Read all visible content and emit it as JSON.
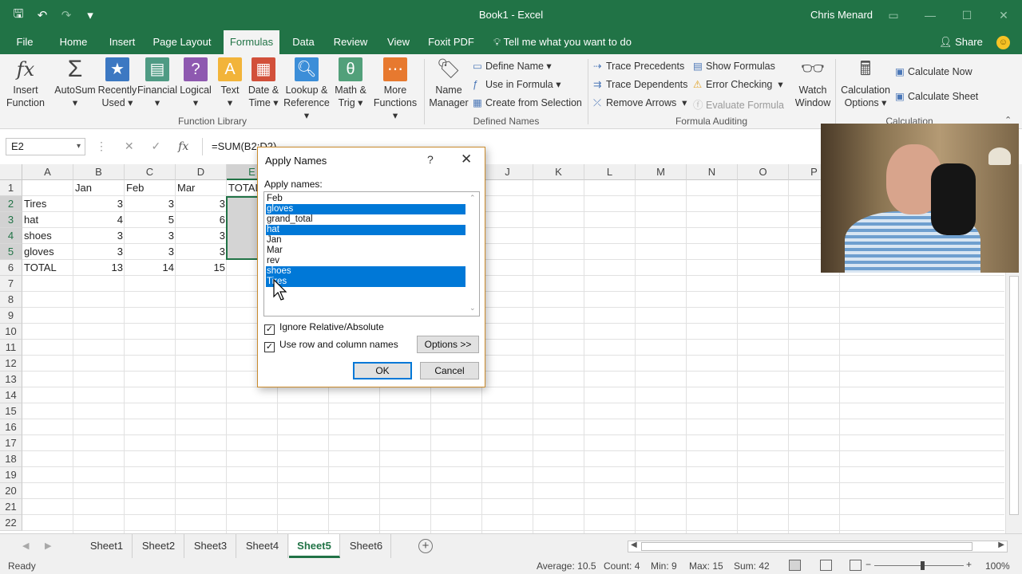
{
  "window": {
    "doc_title": "Book1  -  Excel",
    "user_name": "Chris Menard"
  },
  "tabs": [
    "File",
    "Home",
    "Insert",
    "Page Layout",
    "Formulas",
    "Data",
    "Review",
    "View",
    "Foxit PDF"
  ],
  "active_tab": "Formulas",
  "tell_me": "Tell me what you want to do",
  "share_label": "Share",
  "ribbon": {
    "function_library": {
      "label": "Function Library",
      "buttons": [
        {
          "line1": "Insert",
          "line2": "Function"
        },
        {
          "line1": "AutoSum",
          "line2": "▾"
        },
        {
          "line1": "Recently",
          "line2": "Used ▾"
        },
        {
          "line1": "Financial",
          "line2": "▾"
        },
        {
          "line1": "Logical",
          "line2": "▾"
        },
        {
          "line1": "Text",
          "line2": "▾"
        },
        {
          "line1": "Date &",
          "line2": "Time ▾"
        },
        {
          "line1": "Lookup &",
          "line2": "Reference ▾"
        },
        {
          "line1": "Math &",
          "line2": "Trig ▾"
        },
        {
          "line1": "More",
          "line2": "Functions ▾"
        }
      ]
    },
    "defined_names": {
      "label": "Defined Names",
      "name_manager": {
        "line1": "Name",
        "line2": "Manager"
      },
      "items": [
        "Define Name",
        "Use in Formula",
        "Create from Selection"
      ]
    },
    "formula_auditing": {
      "label": "Formula Auditing",
      "items": [
        "Trace Precedents",
        "Trace Dependents",
        "Remove Arrows",
        "Show Formulas",
        "Error Checking",
        "Evaluate Formula"
      ],
      "watch_window": {
        "line1": "Watch",
        "line2": "Window"
      }
    },
    "calculation": {
      "label": "Calculation",
      "options": {
        "line1": "Calculation",
        "line2": "Options ▾"
      },
      "items": [
        "Calculate Now",
        "Calculate Sheet"
      ]
    }
  },
  "formula_bar": {
    "name_box": "E2",
    "formula": "=SUM(B2:D2)"
  },
  "sheet": {
    "columns": [
      "A",
      "B",
      "C",
      "D",
      "E",
      "F",
      "G",
      "H",
      "I",
      "J",
      "K",
      "L",
      "M",
      "N",
      "O",
      "P"
    ],
    "rows": [
      "1",
      "2",
      "3",
      "4",
      "5",
      "6",
      "7",
      "8",
      "9",
      "10",
      "11",
      "12",
      "13",
      "14",
      "15",
      "16",
      "17",
      "18",
      "19",
      "20",
      "21",
      "22"
    ],
    "cells": {
      "B1": "Jan",
      "C1": "Feb",
      "D1": "Mar",
      "E1": "TOTAL",
      "A2": "Tires",
      "B2": "3",
      "C2": "3",
      "D2": "3",
      "A3": "hat",
      "B3": "4",
      "C3": "5",
      "D3": "6",
      "A4": "shoes",
      "B4": "3",
      "C4": "3",
      "D4": "3",
      "A5": "gloves",
      "B5": "3",
      "C5": "3",
      "D5": "3",
      "A6": "TOTAL",
      "B6": "13",
      "C6": "14",
      "D6": "15"
    }
  },
  "sheet_tabs": [
    "Sheet1",
    "Sheet2",
    "Sheet3",
    "Sheet4",
    "Sheet5",
    "Sheet6"
  ],
  "active_sheet": "Sheet5",
  "status": {
    "mode": "Ready",
    "average": "Average: 10.5",
    "count": "Count: 4",
    "min": "Min: 9",
    "max": "Max: 15",
    "sum": "Sum: 42",
    "zoom": "100%"
  },
  "dialog": {
    "title": "Apply Names",
    "help": "?",
    "label": "Apply names:",
    "names": [
      {
        "text": "Feb",
        "selected": false
      },
      {
        "text": "gloves",
        "selected": true
      },
      {
        "text": "grand_total",
        "selected": false
      },
      {
        "text": "hat",
        "selected": true
      },
      {
        "text": "Jan",
        "selected": false
      },
      {
        "text": "Mar",
        "selected": false
      },
      {
        "text": "rev",
        "selected": false
      },
      {
        "text": "shoes",
        "selected": true
      },
      {
        "text": "Tires",
        "selected": true
      }
    ],
    "ignore_relative": {
      "label": "Ignore Relative/Absolute",
      "checked": true
    },
    "use_row_column": {
      "label": "Use row and column names",
      "checked": true
    },
    "options_label": "Options >>",
    "ok_label": "OK",
    "cancel_label": "Cancel"
  }
}
